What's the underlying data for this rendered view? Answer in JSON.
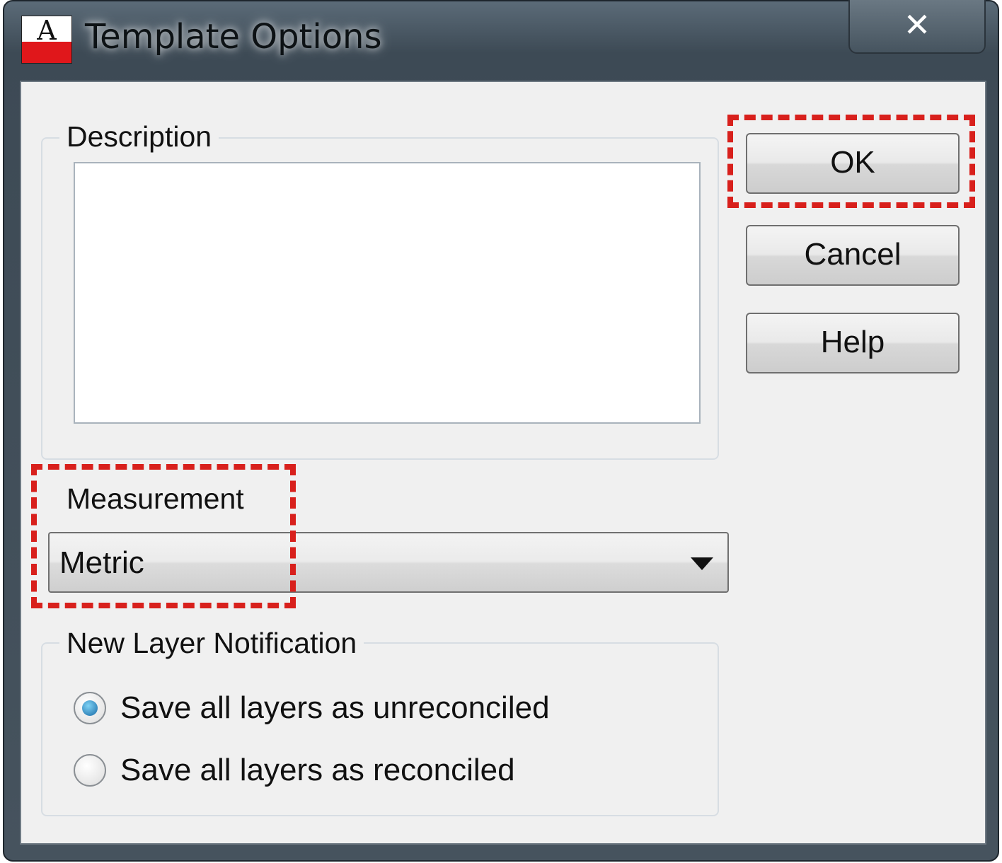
{
  "window": {
    "title": "Template Options",
    "app_icon_letter": "A",
    "close_label": "✕",
    "colors": {
      "app_icon_red": "#e0171b",
      "highlight_red": "#d8201c",
      "radio_selected": "#1769a6"
    }
  },
  "description": {
    "label": "Description",
    "value": ""
  },
  "buttons": {
    "ok": "OK",
    "cancel": "Cancel",
    "help": "Help"
  },
  "measurement": {
    "label": "Measurement",
    "selected": "Metric"
  },
  "new_layer_notification": {
    "label": "New Layer Notification",
    "options": [
      {
        "label": "Save all layers as unreconciled",
        "checked": true
      },
      {
        "label": "Save all layers as reconciled",
        "checked": false
      }
    ]
  }
}
